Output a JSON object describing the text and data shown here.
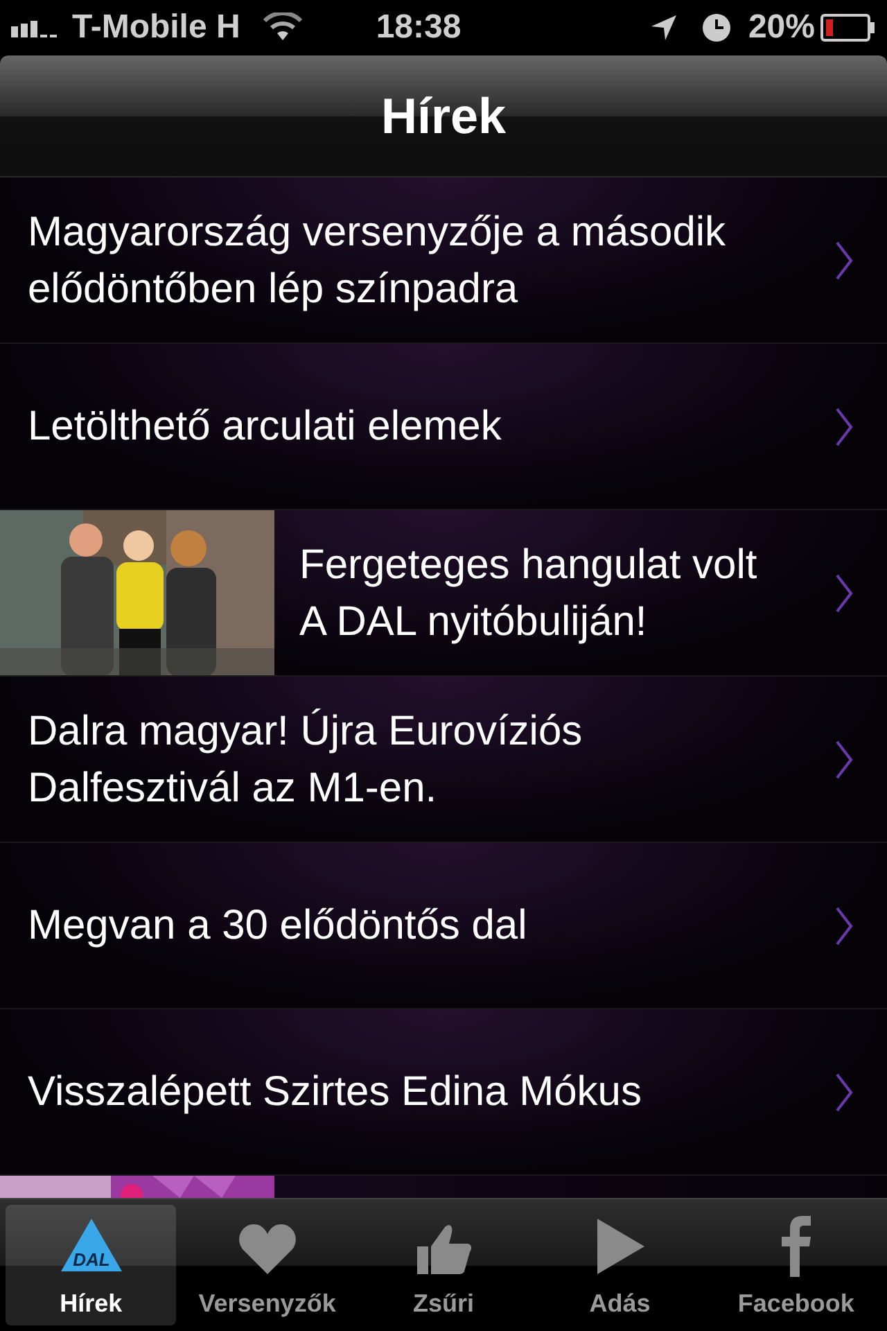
{
  "status_bar": {
    "carrier": "T-Mobile H",
    "time": "18:38",
    "battery": "20%"
  },
  "nav": {
    "title": "Hírek"
  },
  "rows": [
    {
      "kind": "text",
      "title": "Magyarország versenyzője a második elődöntőben lép színpadra"
    },
    {
      "kind": "text",
      "title": "Letölthető arculati elemek"
    },
    {
      "kind": "picture",
      "title": "Fergeteges hangulat volt A DAL nyitóbuliján!"
    },
    {
      "kind": "text",
      "title": "Dalra magyar! Újra Eurovíziós Dalfesztivál az M1-en."
    },
    {
      "kind": "text",
      "title": "Megvan a 30 elődöntős dal"
    },
    {
      "kind": "text",
      "title": "Visszalépett Szirtes Edina Mókus"
    },
    {
      "kind": "partial"
    }
  ],
  "tabs": [
    {
      "label": "Hírek",
      "kind": "logo",
      "logo_text": "DAL",
      "selected": true
    },
    {
      "label": "Versenyzők",
      "kind": "heart",
      "selected": false
    },
    {
      "label": "Zsűri",
      "kind": "thumb",
      "selected": false
    },
    {
      "label": "Adás",
      "kind": "play",
      "selected": false
    },
    {
      "label": "Facebook",
      "kind": "facebook",
      "selected": false
    }
  ]
}
